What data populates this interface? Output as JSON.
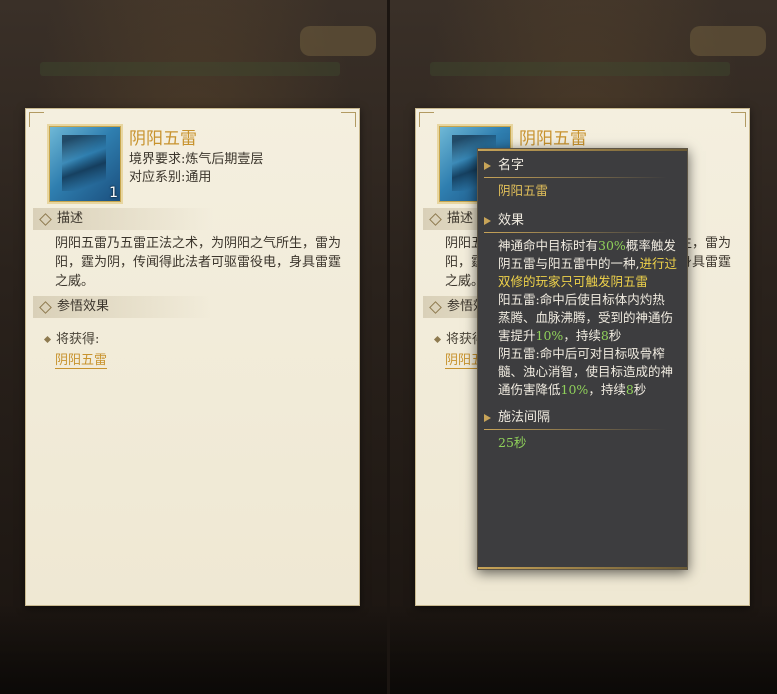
{
  "card": {
    "item_name": "阴阳五雷",
    "item_count": "1",
    "realm_label": "境界要求:",
    "realm_value": "炼气后期壹层",
    "system_label": "对应系别:",
    "system_value": "通用",
    "desc_heading": "描述",
    "desc_text": "阴阳五雷乃五雷正法之术，为阴阳之气所生，雷为阳，霆为阴，传闻得此法者可驱雷役电，身具雷霆之威。",
    "effect_heading": "参悟效果",
    "gain_label": "将获得:",
    "gain_link": "阴阳五雷"
  },
  "tooltip": {
    "name_heading": "名字",
    "name_value": "阴阳五雷",
    "effect_heading": "效果",
    "effect_p1_a": "神通命中目标时有",
    "effect_p1_pct": "30%",
    "effect_p1_b": "概率触发阴五雷与阳五雷中的一种,",
    "effect_p1_note": "进行过双修的玩家只可触发阴五雷",
    "effect_p2_a": "阳五雷:命中后使目标体内灼热蒸腾、血脉沸腾，受到的神通伤害提升",
    "effect_p2_pct": "10%",
    "effect_p2_b": "，持续",
    "effect_p2_sec": "8",
    "effect_p2_c": "秒",
    "effect_p3_a": "阴五雷:命中后可对目标吸骨榨髓、浊心消智，使目标造成的神通伤害降低",
    "effect_p3_pct": "10%",
    "effect_p3_b": "，持续",
    "effect_p3_sec": "8",
    "effect_p3_c": "秒",
    "cooldown_heading": "施法间隔",
    "cooldown_value": "25秒"
  },
  "colors": {
    "accent_gold": "#c8932e",
    "highlight_green": "#8fd05a",
    "highlight_yellow": "#efd24a"
  }
}
